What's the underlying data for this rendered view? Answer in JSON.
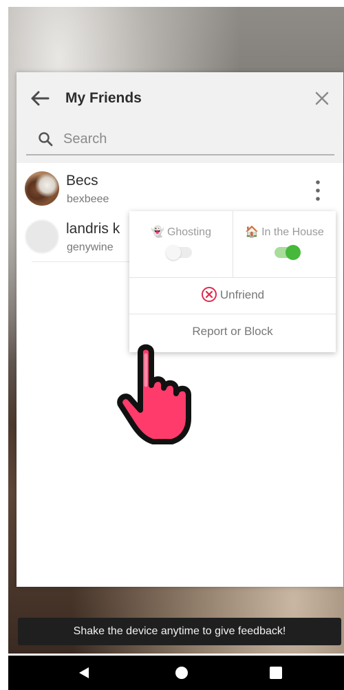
{
  "header": {
    "title": "My Friends",
    "back_icon": "arrow-left-icon",
    "close_icon": "close-icon"
  },
  "search": {
    "placeholder": "Search",
    "value": ""
  },
  "friends": [
    {
      "name": "Becs",
      "username": "bexbeee",
      "avatar": "photo"
    },
    {
      "name": "landris k",
      "username": "genywine",
      "avatar": "placeholder"
    }
  ],
  "menu": {
    "ghosting": {
      "label": "Ghosting",
      "emoji": "👻",
      "enabled": false
    },
    "in_the_house": {
      "label": "In the House",
      "emoji": "🏠",
      "enabled": true
    },
    "unfriend_label": "Unfriend",
    "report_label": "Report or Block"
  },
  "toast": "Shake the device anytime to give feedback!",
  "colors": {
    "toggle_on": "#46b83a",
    "unfriend_red": "#e0294a",
    "hand_pink": "#ff3b6b"
  }
}
